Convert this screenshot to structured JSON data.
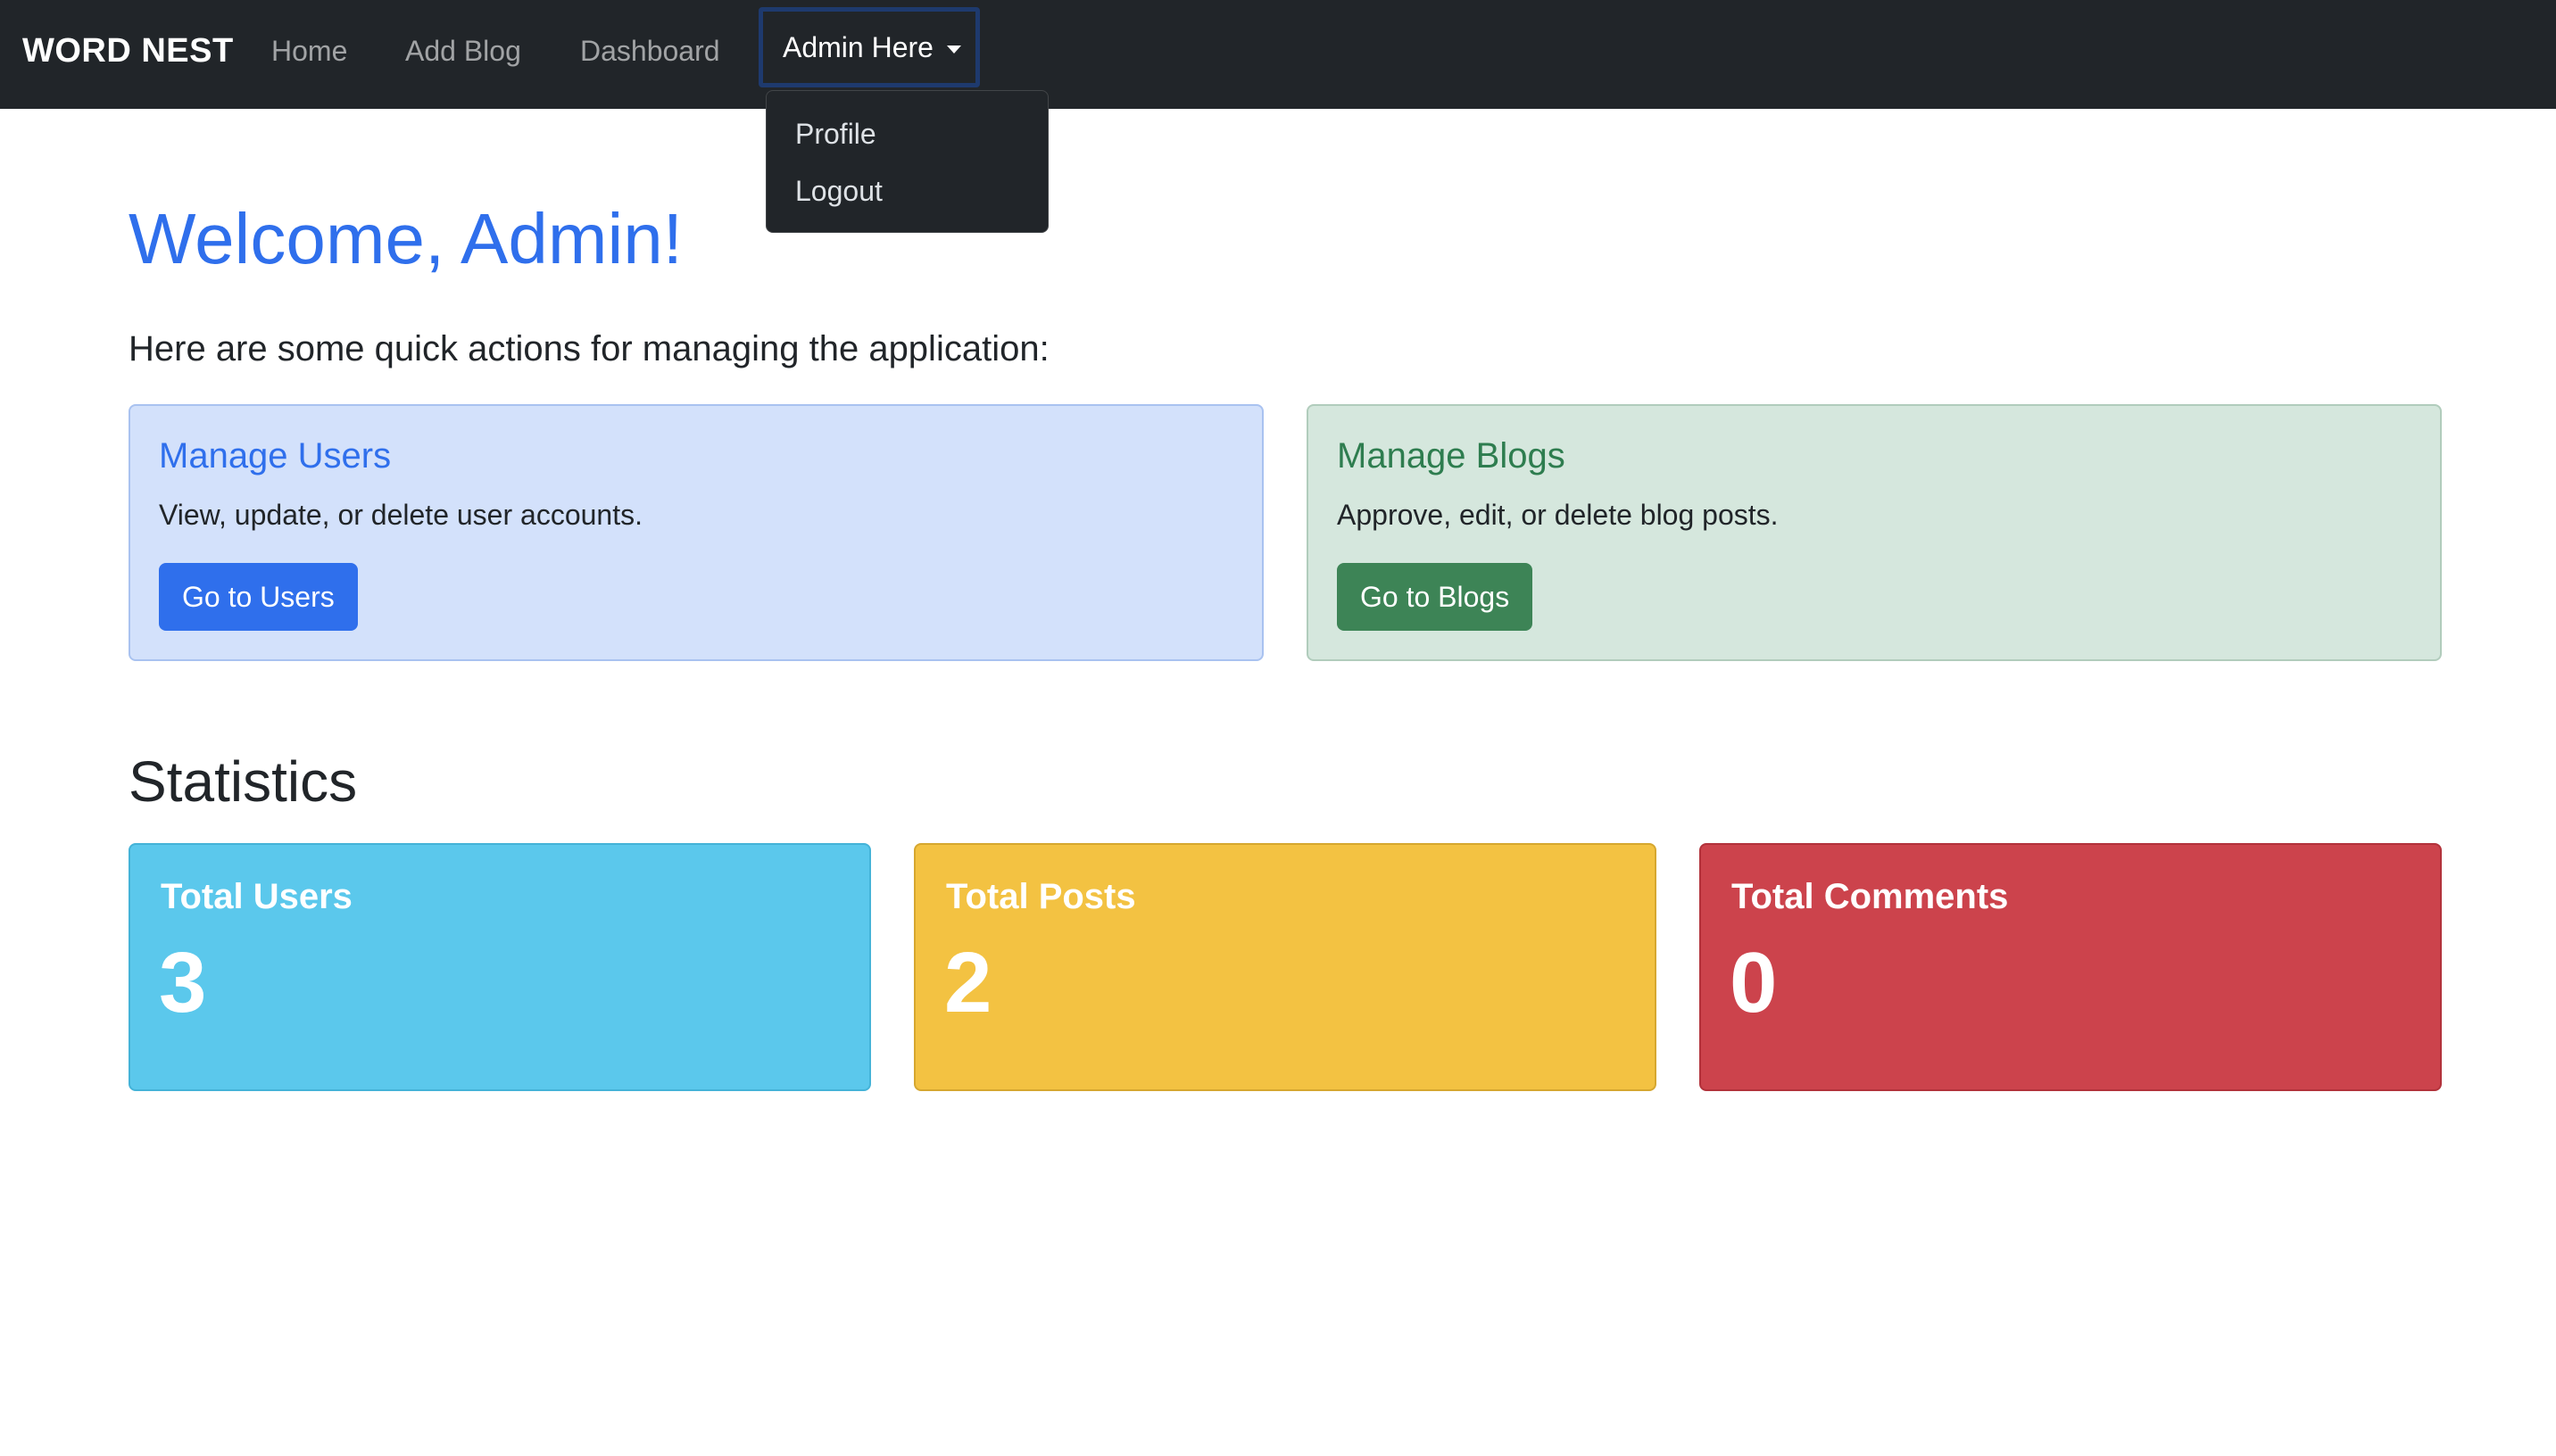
{
  "navbar": {
    "brand": "WORD NEST",
    "links": [
      {
        "label": "Home"
      },
      {
        "label": "Add Blog"
      },
      {
        "label": "Dashboard"
      }
    ],
    "user_menu": {
      "label": "Admin Here",
      "items": [
        {
          "label": "Profile"
        },
        {
          "label": "Logout"
        }
      ]
    }
  },
  "main": {
    "welcome": "Welcome, Admin!",
    "lead": "Here are some quick actions for managing the application:",
    "cards": [
      {
        "title": "Manage Users",
        "text": "View, update, or delete user accounts.",
        "button": "Go to Users",
        "color": "#2f6fec"
      },
      {
        "title": "Manage Blogs",
        "text": "Approve, edit, or delete blog posts.",
        "button": "Go to Blogs",
        "color": "#3d8456"
      }
    ],
    "statistics": {
      "heading": "Statistics",
      "items": [
        {
          "title": "Total Users",
          "value": "3",
          "color": "#5bc8ec"
        },
        {
          "title": "Total Posts",
          "value": "2",
          "color": "#f3c242"
        },
        {
          "title": "Total Comments",
          "value": "0",
          "color": "#cc434c"
        }
      ]
    }
  }
}
